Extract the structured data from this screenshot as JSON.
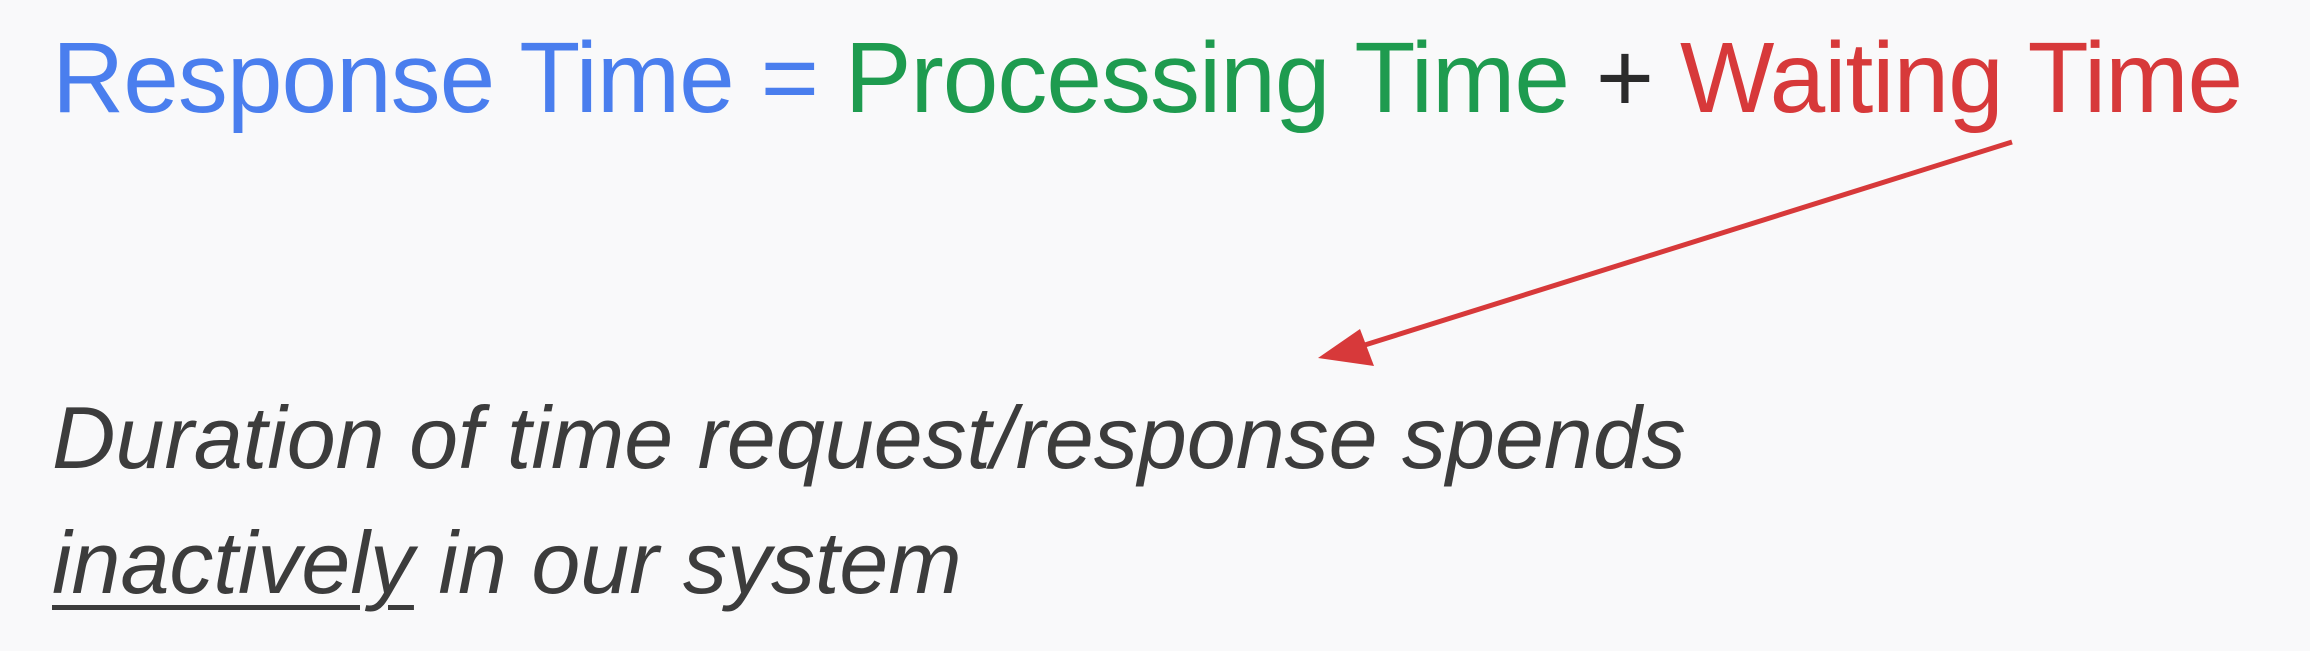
{
  "formula": {
    "response_time": "Response Time",
    "equals": "=",
    "processing_time": "Processing Time",
    "plus": "+",
    "waiting_time": "Waiting Time"
  },
  "description": {
    "line1": "Duration of time request/response spends",
    "line2_underlined": "inactively",
    "line2_rest": " in our system"
  },
  "colors": {
    "response": "#4a7eee",
    "processing": "#1e9b4f",
    "operator_plus": "#2b2b2b",
    "waiting": "#d7393a",
    "arrow": "#d7393a",
    "description_text": "#3c3c3c"
  },
  "arrow": {
    "from": "waiting_time",
    "to": "description"
  }
}
